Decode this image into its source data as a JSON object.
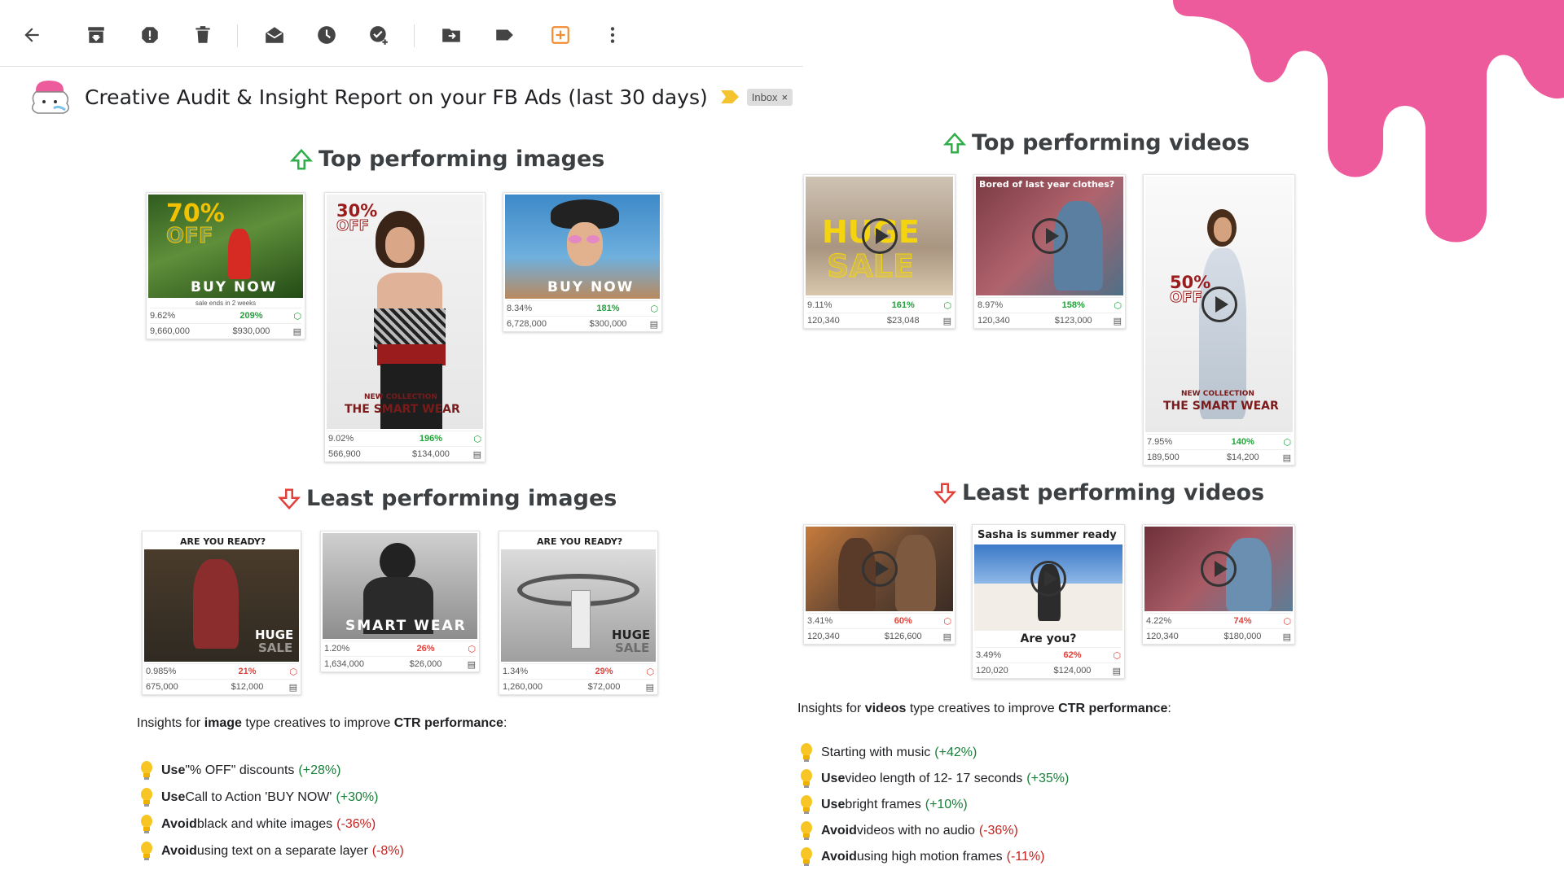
{
  "subject": "Creative Audit & Insight Report on your FB Ads (last 30 days)",
  "inbox_label": "Inbox",
  "inbox_close": "×",
  "sections": {
    "top_images": "Top performing images",
    "least_images": "Least performing images",
    "top_videos": "Top performing videos",
    "least_videos": "Least performing videos"
  },
  "top_images": [
    {
      "overlay": "70%",
      "overlay2": "OFF",
      "cta": "BUY NOW",
      "note": "sale ends in 2 weeks",
      "ctr": "9.62%",
      "change": "209%",
      "impressions": "9,660,000",
      "spend": "$930,000"
    },
    {
      "overlay": "30%",
      "overlay2": "OFF",
      "cta": "NEW COLLECTION",
      "brand": "THE SMART WEAR",
      "ctr": "9.02%",
      "change": "196%",
      "impressions": "566,900",
      "spend": "$134,000"
    },
    {
      "cta": "BUY NOW",
      "ctr": "8.34%",
      "change": "181%",
      "impressions": "6,728,000",
      "spend": "$300,000"
    }
  ],
  "least_images": [
    {
      "headline": "ARE YOU READY?",
      "overlay": "HUGE",
      "overlay2": "SALE",
      "ctr": "0.985%",
      "change": "21%",
      "impressions": "675,000",
      "spend": "$12,000"
    },
    {
      "headline": "SMART WEAR",
      "ctr": "1.20%",
      "change": "26%",
      "impressions": "1,634,000",
      "spend": "$26,000"
    },
    {
      "headline": "ARE YOU READY?",
      "overlay": "HUGE",
      "overlay2": "SALE",
      "ctr": "1.34%",
      "change": "29%",
      "impressions": "1,260,000",
      "spend": "$72,000"
    }
  ],
  "top_videos": [
    {
      "overlay": "HUGE",
      "overlay2": "SALE",
      "ctr": "9.11%",
      "change": "161%",
      "impressions": "120,340",
      "spend": "$23,048"
    },
    {
      "headline": "Bored of last year clothes?",
      "ctr": "8.97%",
      "change": "158%",
      "impressions": "120,340",
      "spend": "$123,000"
    },
    {
      "overlay": "50%",
      "overlay2": "OFF",
      "cta": "NEW COLLECTION",
      "brand": "THE SMART WEAR",
      "ctr": "7.95%",
      "change": "140%",
      "impressions": "189,500",
      "spend": "$14,200"
    }
  ],
  "least_videos": [
    {
      "ctr": "3.41%",
      "change": "60%",
      "impressions": "120,340",
      "spend": "$126,600"
    },
    {
      "headline": "Sasha is summer ready",
      "footer": "Are you?",
      "ctr": "3.49%",
      "change": "62%",
      "impressions": "120,020",
      "spend": "$124,000"
    },
    {
      "ctr": "4.22%",
      "change": "74%",
      "impressions": "120,340",
      "spend": "$180,000"
    }
  ],
  "image_insights": {
    "prefix": "Insights for ",
    "type": "image",
    "middle": " type creatives to improve ",
    "metric": "CTR performance",
    "suffix": ":",
    "items": [
      {
        "verb": "Use",
        "text": " \"% OFF\" discounts",
        "impact": "(+28%)",
        "positive": true
      },
      {
        "verb": "Use",
        "text": " Call to Action 'BUY NOW'",
        "impact": "(+30%)",
        "positive": true
      },
      {
        "verb": "Avoid",
        "text": " black and white images",
        "impact": "(-36%)",
        "positive": false
      },
      {
        "verb": "Avoid",
        "text": " using text on a separate layer",
        "impact": "(-8%)",
        "positive": false
      }
    ]
  },
  "video_insights": {
    "prefix": "Insights for ",
    "type": "videos",
    "middle": " type creatives to improve ",
    "metric": "CTR performance",
    "suffix": ":",
    "items": [
      {
        "verb": "",
        "text": "Starting with music",
        "impact": "(+42%)",
        "positive": true
      },
      {
        "verb": "Use",
        "text": " video length of 12- 17 seconds",
        "impact": "(+35%)",
        "positive": true
      },
      {
        "verb": "Use",
        "text": " bright frames",
        "impact": "(+10%)",
        "positive": true
      },
      {
        "verb": "Avoid",
        "text": " videos with no audio",
        "impact": "(-36%)",
        "positive": false
      },
      {
        "verb": "Avoid",
        "text": " using high motion frames",
        "impact": "(-11%)",
        "positive": false
      }
    ]
  },
  "colors": {
    "accent_pink": "#ee5b9c",
    "positive": "#188038",
    "negative": "#c5221f",
    "highlight_orange": "#f28b30"
  }
}
